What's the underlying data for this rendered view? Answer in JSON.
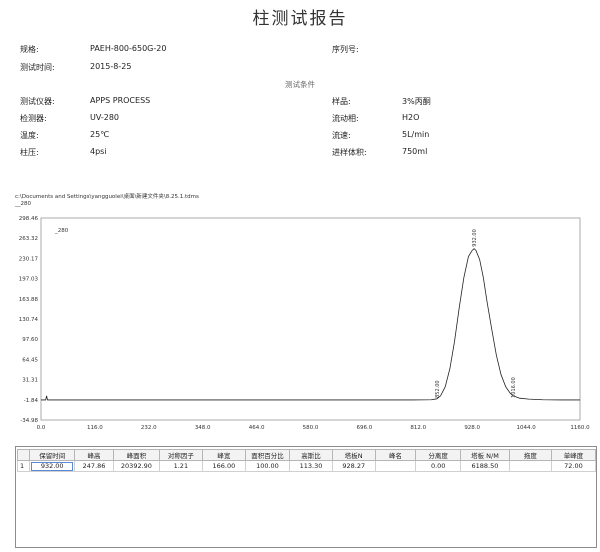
{
  "report_title": "柱测试报告",
  "info": {
    "spec_label": "规格:",
    "spec_value": "PAEH-800-650G-20",
    "serial_label": "序列号:",
    "time_label": "测试时间:",
    "time_value": "2015-8-25",
    "conditions_title": "测试条件",
    "instrument_label": "测试仪器:",
    "instrument_value": "APPS PROCESS",
    "sample_label": "样品:",
    "sample_value": "3%丙酮",
    "detector_label": "检测器:",
    "detector_value": "UV-280",
    "mobile_phase_label": "流动相:",
    "mobile_phase_value": "H2O",
    "temp_label": "温度:",
    "temp_value": "25℃",
    "flow_label": "流速:",
    "flow_value": "5L/min",
    "pressure_label": "柱压:",
    "pressure_value": "4psi",
    "injection_label": "进样体积:",
    "injection_value": "750ml"
  },
  "chart_path": "c:\\Documents and Settings\\yangguolei\\桌面\\新建文件夹\\8.25.1.tdms",
  "chart_data": {
    "type": "line",
    "legend": "__280",
    "inner_label": "_280",
    "y_ticks": [
      "298.46",
      "263.32",
      "230.17",
      "197.03",
      "163.88",
      "130.74",
      "97.60",
      "64.45",
      "31.31",
      "-1.84",
      "-34.98"
    ],
    "x_ticks": [
      "0.0",
      "116.0",
      "232.0",
      "348.0",
      "464.0",
      "580.0",
      "696.0",
      "812.0",
      "928.0",
      "1044.0",
      "1160.0"
    ],
    "xlim": [
      0,
      1160
    ],
    "ylim": [
      -34.98,
      298.46
    ],
    "grid": true,
    "annotations": [
      {
        "text": "932.00",
        "x": 932,
        "y": 247.86
      },
      {
        "text": "852.00",
        "x": 852,
        "y": -1.84
      },
      {
        "text": "1016.00",
        "x": 1016,
        "y": -1.84
      }
    ],
    "series": [
      {
        "x": [
          0,
          10,
          12,
          14,
          30,
          100,
          300,
          500,
          700,
          800,
          840,
          852,
          860,
          870,
          880,
          890,
          900,
          910,
          920,
          928,
          932,
          936,
          944,
          952,
          960,
          970,
          980,
          990,
          1000,
          1010,
          1016,
          1030,
          1050,
          1080,
          1120,
          1160
        ],
        "y": [
          -1.84,
          -1.84,
          5,
          -1.84,
          -1.84,
          -1.84,
          -1.84,
          -1.84,
          -1.84,
          -1.84,
          -1.5,
          0,
          5,
          20,
          50,
          95,
          150,
          200,
          235,
          245,
          247.86,
          245,
          230,
          200,
          160,
          115,
          72,
          40,
          20,
          9,
          5,
          1,
          -0.5,
          -1.5,
          -1.84,
          -1.84
        ]
      }
    ]
  },
  "results": {
    "headers": [
      "",
      "保留时间",
      "峰高",
      "峰面积",
      "对称因子",
      "峰宽",
      "面积百分比",
      "高斯比",
      "塔板N",
      "峰名",
      "分离度",
      "塔板 N/M",
      "拖度",
      "单峰度"
    ],
    "rows": [
      [
        "1",
        "932.00",
        "247.86",
        "20392.90",
        "1.21",
        "166.00",
        "100.00",
        "113.30",
        "928.27",
        "",
        "0.00",
        "6188.50",
        "",
        "72.00"
      ]
    ]
  }
}
